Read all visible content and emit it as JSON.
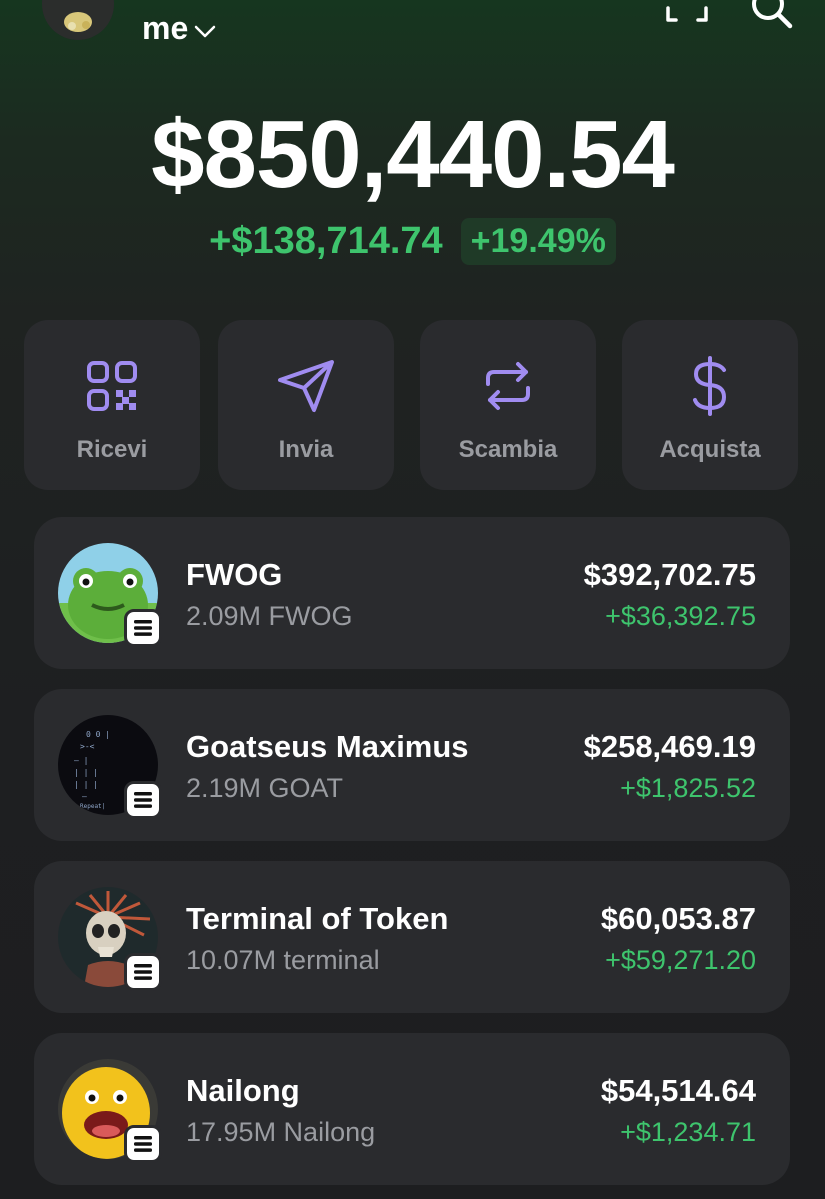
{
  "header": {
    "account_name": "me",
    "icons": [
      "avatar",
      "chevron-down-icon",
      "scan-icon",
      "search-icon"
    ]
  },
  "portfolio": {
    "balance": "$850,440.54",
    "change_amount": "+$138,714.74",
    "change_percent": "+19.49%"
  },
  "actions": [
    {
      "label": "Ricevi",
      "icon": "qr-code-icon"
    },
    {
      "label": "Invia",
      "icon": "send-icon"
    },
    {
      "label": "Scambia",
      "icon": "swap-icon"
    },
    {
      "label": "Acquista",
      "icon": "dollar-icon"
    }
  ],
  "tokens": [
    {
      "name": "FWOG",
      "amount": "2.09M FWOG",
      "value": "$392,702.75",
      "change": "+$36,392.75"
    },
    {
      "name": "Goatseus Maximus",
      "amount": "2.19M GOAT",
      "value": "$258,469.19",
      "change": "+$1,825.52",
      "image_text": "Repeat|"
    },
    {
      "name": "Terminal of Token",
      "amount": "10.07M terminal",
      "value": "$60,053.87",
      "change": "+$59,271.20"
    },
    {
      "name": "Nailong",
      "amount": "17.95M Nailong",
      "value": "$54,514.64",
      "change": "+$1,234.71"
    }
  ],
  "colors": {
    "accent": "#a08cf0",
    "positive": "#3ec46d",
    "card": "#2a2b2e",
    "background": "#1e1f21"
  }
}
